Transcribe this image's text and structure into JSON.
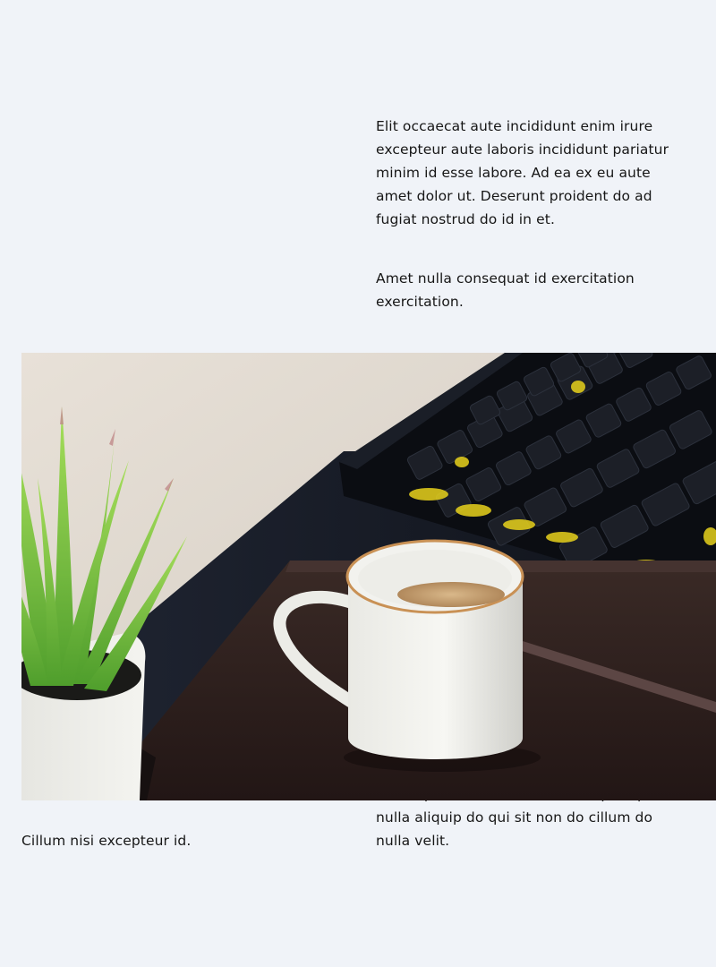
{
  "paragraphs": {
    "p1": "Elit occaecat aute incididunt enim irure excepteur aute laboris incididunt pariatur minim id esse labore. Ad ea ex eu aute amet dolor ut. Deserunt proident do ad fugiat nostrud do id in et.",
    "p2": "Amet nulla consequat id exercitation exercitation.",
    "p3": "Est do proident et labore consequat qui nulla aliquip do qui sit non do cillum do nulla velit.",
    "p4": "Cillum nisi excepteur id."
  },
  "colors": {
    "background": "#f0f3f8",
    "text": "#161616"
  }
}
